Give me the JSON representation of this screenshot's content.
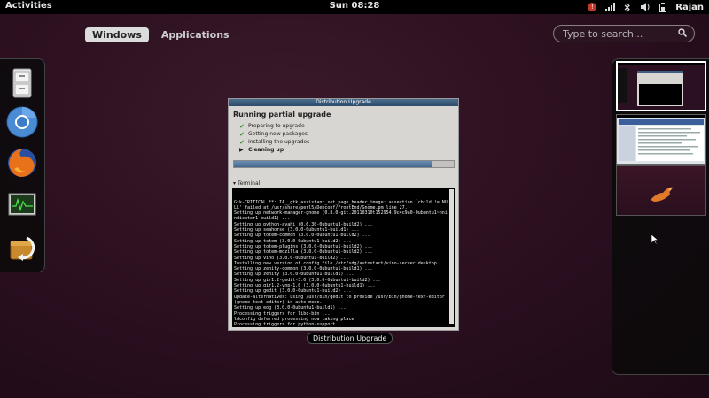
{
  "panel": {
    "activities": "Activities",
    "clock": "Sun 08:28",
    "user": "Rajan",
    "tray_icons": [
      "notification-icon",
      "network-icon",
      "bluetooth-icon",
      "volume-icon",
      "battery-icon"
    ]
  },
  "views": {
    "windows": "Windows",
    "applications": "Applications"
  },
  "search": {
    "placeholder": "Type to search..."
  },
  "dock": [
    "file-cabinet-icon",
    "chromium-icon",
    "firefox-icon",
    "system-monitor-icon",
    "update-manager-icon"
  ],
  "window": {
    "titlebar": "Distribution Upgrade",
    "heading": "Running partial upgrade",
    "steps": [
      {
        "label": "Preparing to upgrade",
        "state": "done"
      },
      {
        "label": "Getting new packages",
        "state": "done"
      },
      {
        "label": "Installing the upgrades",
        "state": "done"
      },
      {
        "label": "Cleaning up",
        "state": "current"
      }
    ],
    "progress": 0.9,
    "terminal_label": "Terminal",
    "terminal_lines": [
      "Gtk-CRITICAL **: IA__gtk_assistant_set_page_header_image: assertion `child != NU",
      "LL' failed at /usr/share/perl5/Debconf/FrontEnd/Gnome.pm line 27.",
      "Setting up network-manager-gnome (0.8.0-git.20110310t152954.9c4c9a0-0ubuntu1~nni",
      "ndicator1-build1) ...",
      "Setting up python-avahi (0.6.30-0ubuntu3-build2) ...",
      "Setting up seahorse (3.0.0-0ubuntu1-build1) ...",
      "Setting up totem-common (3.0.0-0ubuntu1-build2) ...",
      "Setting up totem (3.0.0-0ubuntu1-build2) ...",
      "Setting up totem-plugins (3.0.0-0ubuntu1-build2) ...",
      "Setting up totem-mozilla (3.0.0-0ubuntu1-build2) ...",
      "Setting up vino (3.0.0-0ubuntu1-build2) ...",
      "Installing new version of config file /etc/xdg/autostart/vino-server.desktop ...",
      "Setting up zenity-common (3.0.0-0ubuntu1-build1) ...",
      "Setting up zenity (3.0.0-0ubuntu1-build1) ...",
      "Setting up gir1.2-gedit-3.0 (3.0.0-0ubuntu1-build2) ...",
      "Setting up gir1.2-vnp-1.0 (3.0.0-0ubuntu1-build1) ...",
      "Setting up gedit (3.0.0-0ubuntu1-build2) ...",
      "update-alternatives: using /usr/bin/gedit to provide /usr/bin/gnome-text-editor",
      "(gnome-text-editor) in auto mode.",
      "Setting up eog (3.0.0-0ubuntu1-build1) ...",
      "Processing triggers for libc-bin ...",
      "ldconfig deferred processing now taking place",
      "Processing triggers for python-support ..."
    ]
  },
  "caption": "Distribution Upgrade",
  "colors": {
    "background": "#2a0f1f",
    "panel": "#000000",
    "progress_fill": "#44678f",
    "check": "#2e8b2e"
  }
}
